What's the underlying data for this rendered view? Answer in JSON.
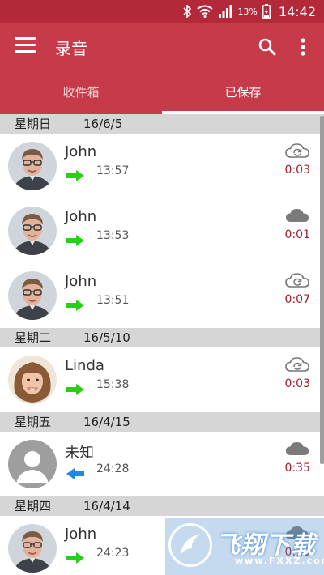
{
  "status_bar": {
    "battery": "13%",
    "time": "14:42"
  },
  "app_bar": {
    "title": "录音"
  },
  "tabs": [
    {
      "label": "收件箱",
      "selected": false
    },
    {
      "label": "已保存",
      "selected": true
    }
  ],
  "groups": [
    {
      "day": "星期日",
      "date": "16/6/5",
      "items": [
        {
          "name": "John",
          "time": "13:57",
          "duration": "0:03",
          "direction": "outgoing",
          "cloud": "cloud-sync-icon",
          "avatar": "man"
        },
        {
          "name": "John",
          "time": "13:53",
          "duration": "0:01",
          "direction": "outgoing",
          "cloud": "cloud-icon",
          "avatar": "man"
        },
        {
          "name": "John",
          "time": "13:51",
          "duration": "0:07",
          "direction": "outgoing",
          "cloud": "cloud-sync-icon",
          "avatar": "man"
        }
      ]
    },
    {
      "day": "星期二",
      "date": "16/5/10",
      "items": [
        {
          "name": "Linda",
          "time": "15:38",
          "duration": "0:03",
          "direction": "outgoing",
          "cloud": "cloud-sync-icon",
          "avatar": "woman"
        }
      ]
    },
    {
      "day": "星期五",
      "date": "16/4/15",
      "items": [
        {
          "name": "未知",
          "time": "24:28",
          "duration": "0:35",
          "direction": "incoming",
          "cloud": "cloud-icon",
          "avatar": "unknown"
        }
      ]
    },
    {
      "day": "星期四",
      "date": "16/4/14",
      "items": [
        {
          "name": "John",
          "time": "24:23",
          "duration": "0:13",
          "direction": "outgoing",
          "cloud": "cloud-icon",
          "avatar": "man"
        }
      ]
    }
  ],
  "watermark": {
    "text": "飞翔下载",
    "url": "www.FXXZ.com"
  },
  "colors": {
    "primary": "#c73a4a",
    "status_bar": "#b3293a",
    "outgoing": "#2ecc1a",
    "incoming": "#1e88e5",
    "duration": "#a0202c"
  }
}
